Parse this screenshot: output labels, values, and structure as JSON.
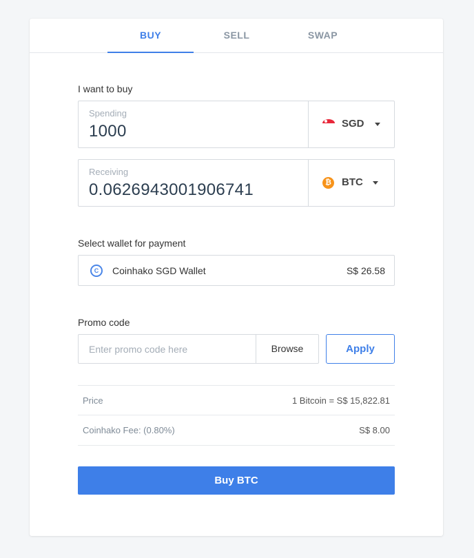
{
  "tabs": [
    {
      "label": "BUY",
      "active": true
    },
    {
      "label": "SELL",
      "active": false
    },
    {
      "label": "SWAP",
      "active": false
    }
  ],
  "buy_section": {
    "heading": "I want to buy",
    "spending": {
      "caption": "Spending",
      "value": "1000",
      "currency": "SGD",
      "icon": "singapore-flag-icon"
    },
    "receiving": {
      "caption": "Receiving",
      "value": "0.0626943001906741",
      "currency": "BTC",
      "icon": "bitcoin-icon"
    }
  },
  "wallet_section": {
    "heading": "Select wallet for payment",
    "wallet_name": "Coinhako SGD Wallet",
    "wallet_balance": "S$ 26.58",
    "icon": "coinhako-icon"
  },
  "promo_section": {
    "heading": "Promo code",
    "placeholder": "Enter promo code here",
    "value": "",
    "browse_label": "Browse",
    "apply_label": "Apply"
  },
  "summary": [
    {
      "key": "Price",
      "value": "1 Bitcoin = S$ 15,822.81"
    },
    {
      "key": "Coinhako Fee: (0.80%)",
      "value": "S$ 8.00"
    }
  ],
  "buy_button_label": "Buy BTC",
  "colors": {
    "accent": "#3e7fe8",
    "bitcoin": "#f7931a",
    "sg_red": "#e8283a"
  }
}
